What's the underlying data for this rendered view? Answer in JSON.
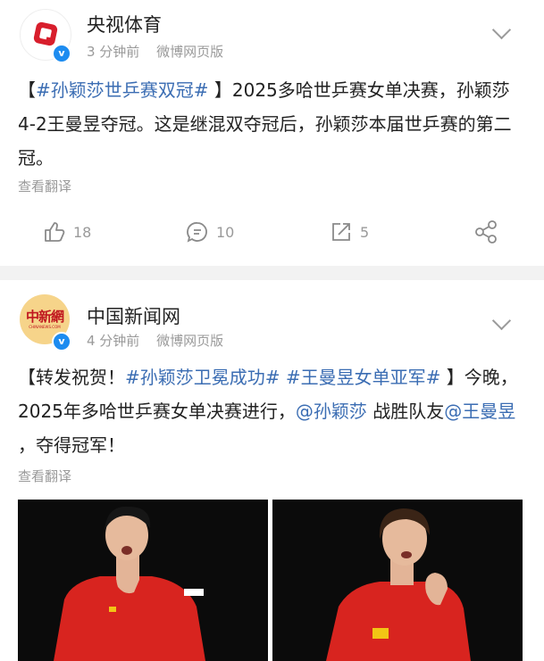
{
  "posts": [
    {
      "author": "央视体育",
      "time": "3 分钟前",
      "source": "微博网页版",
      "text_parts": [
        "【",
        "#孙颖莎世乒赛双冠#",
        " 】2025多哈世乒赛女单决赛，孙颖莎4-2王曼昱夺冠。这是继混双夺冠后，孙颖莎本届世乒赛的第二冠。"
      ],
      "translate": "查看翻译",
      "like_count": "18",
      "comment_count": "10",
      "repost_count": "5"
    },
    {
      "author": "中国新闻网",
      "time": "4 分钟前",
      "source": "微博网页版",
      "avatar_text": "中新網",
      "avatar_subtext": "CHINANEWS.COM",
      "text_parts": [
        "【转发祝贺！",
        "#孙颖莎卫冕成功#",
        " ",
        "#王曼昱女单亚军#",
        " 】今晚，2025年多哈世乒赛女单决赛进行，",
        "@孙颖莎",
        " 战胜队友",
        "@王曼昱",
        " ，夺得冠军！"
      ],
      "translate": "查看翻译"
    }
  ],
  "colors": {
    "link": "#3b6db3",
    "brand_red": "#d81e2c",
    "verified_blue": "#1d8cf0",
    "jersey_red": "#d8241f"
  },
  "icons": {
    "like": "thumbs-up-icon",
    "comment": "comment-icon",
    "repost": "repost-icon",
    "share": "share-icon",
    "expand": "chevron-down-icon"
  }
}
